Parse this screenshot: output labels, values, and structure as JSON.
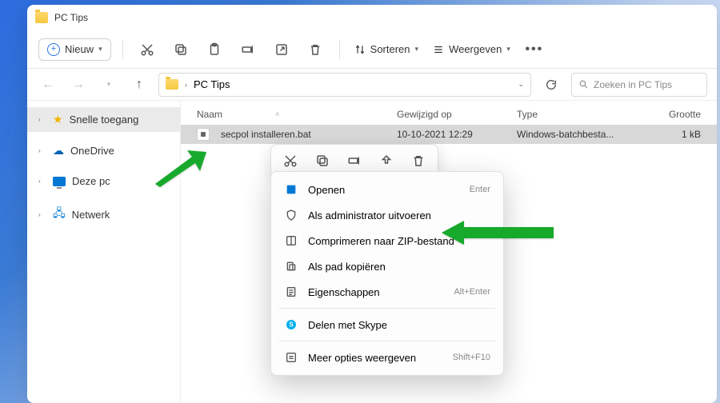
{
  "window": {
    "title": "PC Tips"
  },
  "toolbar": {
    "new_label": "Nieuw",
    "sort_label": "Sorteren",
    "view_label": "Weergeven"
  },
  "breadcrumb": {
    "root_chevron": ">",
    "location": "PC Tips"
  },
  "search": {
    "placeholder": "Zoeken in PC Tips"
  },
  "sidebar": {
    "items": [
      {
        "label": "Snelle toegang"
      },
      {
        "label": "OneDrive"
      },
      {
        "label": "Deze pc"
      },
      {
        "label": "Netwerk"
      }
    ]
  },
  "columns": {
    "name": "Naam",
    "modified": "Gewijzigd op",
    "type": "Type",
    "size": "Grootte"
  },
  "files": [
    {
      "name": "secpol installeren.bat",
      "modified": "10-10-2021 12:29",
      "type": "Windows-batchbesta...",
      "size": "1 kB"
    }
  ],
  "context_menu": {
    "items": [
      {
        "label": "Openen",
        "shortcut": "Enter"
      },
      {
        "label": "Als administrator uitvoeren",
        "shortcut": ""
      },
      {
        "label": "Comprimeren naar ZIP-bestand",
        "shortcut": ""
      },
      {
        "label": "Als pad kopiëren",
        "shortcut": ""
      },
      {
        "label": "Eigenschappen",
        "shortcut": "Alt+Enter"
      },
      {
        "label": "Delen met Skype",
        "shortcut": ""
      },
      {
        "label": "Meer opties weergeven",
        "shortcut": "Shift+F10"
      }
    ]
  }
}
